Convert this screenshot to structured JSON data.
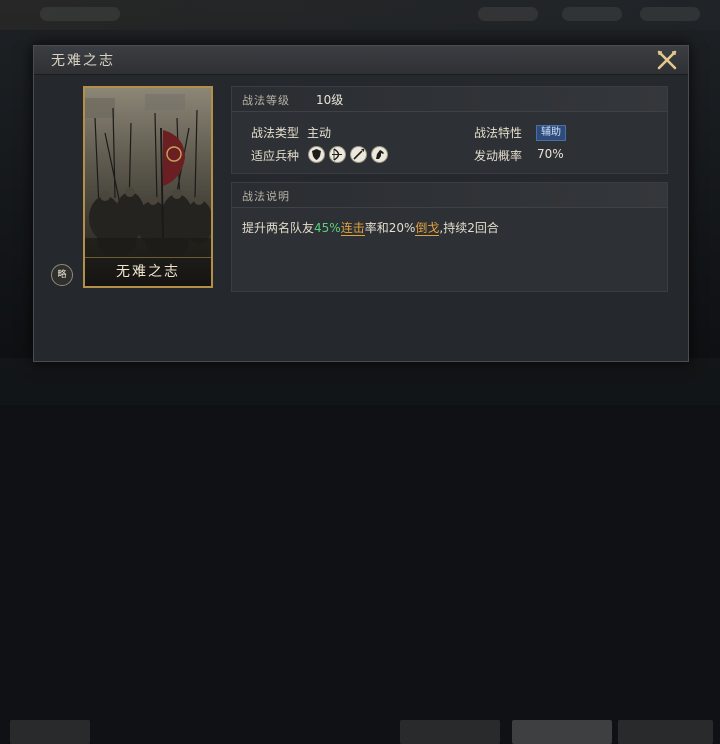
{
  "dialog": {
    "title": "无难之志"
  },
  "card": {
    "name": "无难之志",
    "badge": "略"
  },
  "level_panel": {
    "label": "战法等级",
    "value": "10级"
  },
  "info": {
    "type_label": "战法类型",
    "type_value": "主动",
    "trait_label": "战法特性",
    "trait_value": "辅助",
    "troops_label": "适应兵种",
    "troops": [
      "shield-infantry-icon",
      "bow-archer-icon",
      "spear-icon",
      "cavalry-horse-icon"
    ],
    "rate_label": "发动概率",
    "rate_value": "70%"
  },
  "desc_panel": {
    "label": "战法说明",
    "parts": {
      "p1": "提升两名队友",
      "p2": "45%",
      "p3": "连击",
      "p4": "率和20%",
      "p5": "倒戈",
      "p6": ",持续2回合"
    }
  },
  "colors": {
    "highlight_green": "#5bd07a",
    "highlight_orange": "#e0a241",
    "card_border": "#b38f47",
    "tag_blue": "#2e4c7a"
  }
}
